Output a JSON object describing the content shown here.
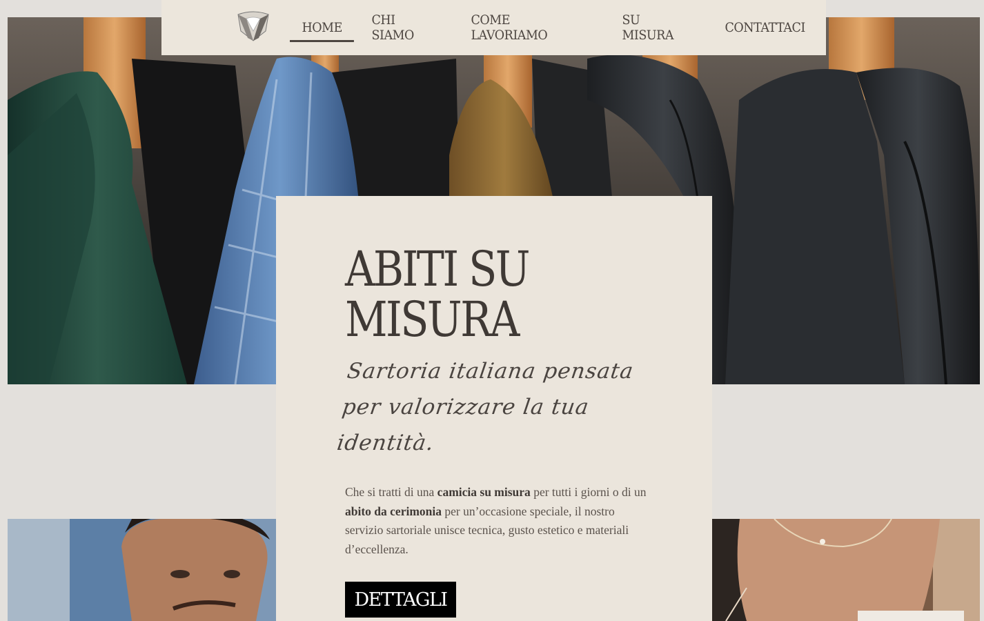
{
  "nav": {
    "logo_icon": "shirt-collar-icon",
    "items": [
      {
        "label": "HOME",
        "active": true
      },
      {
        "label": "CHI SIAMO",
        "active": false
      },
      {
        "label": "COME LAVORIAMO",
        "active": false
      },
      {
        "label": "SU MISURA",
        "active": false
      },
      {
        "label": "CONTATTACI",
        "active": false
      }
    ]
  },
  "hero": {
    "title_line1": "ABITI SU",
    "title_line2": "MISURA",
    "subtitle": "Sartoria italiana pensata per valorizzare la tua identità.",
    "body_part1": "Che si tratti di una ",
    "body_bold1": "camicia su misura",
    "body_part2": " per tutti i giorni o di un ",
    "body_bold2": "abito da cerimonia",
    "body_part3": " per un’occasione speciale, il nostro servizio sartoriale unisce tecnica, gusto estetico e materiali d’eccellenza.",
    "cta_label": "DETTAGLI"
  },
  "colors": {
    "page_bg": "#e3e0dc",
    "card_bg": "#ebe5dc",
    "nav_bg": "#ece6dc",
    "text_dark": "#3f3935",
    "button_bg": "#000000"
  }
}
